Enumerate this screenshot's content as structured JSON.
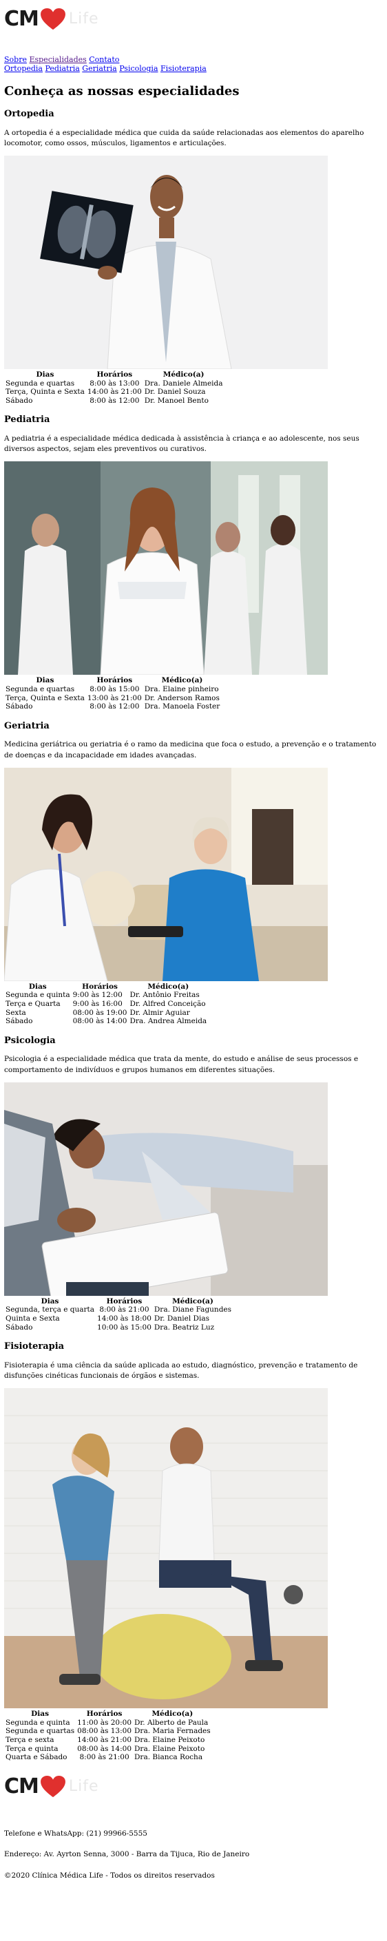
{
  "brand": {
    "logo_text": "CM",
    "logo_faded": "Life"
  },
  "nav": {
    "line1": [
      "Sobre",
      "Especialidades",
      "Contato"
    ],
    "line2": [
      "Ortopedia",
      "Pediatria",
      "Geriatria",
      "Psicologia",
      "Fisioterapia"
    ]
  },
  "page_title": "Conheça as nossas especialidades",
  "table_headers": [
    "Dias",
    "Horários",
    "Médico(a)"
  ],
  "sections": [
    {
      "title": "Ortopedia",
      "description": "A ortopedia é a especialidade médica que cuida da saúde relacionadas aos elementos do aparelho locomotor, como ossos, músculos, ligamentos e articulações.",
      "rows": [
        [
          "Segunda e quartas",
          "8:00 às 13:00",
          "Dra. Daniele Almeida"
        ],
        [
          "Terça, Quinta e Sexta",
          "14:00 às 21:00",
          "Dr. Daniel Souza"
        ],
        [
          "Sábado",
          "8:00 às 12:00",
          "Dr. Manoel Bento"
        ]
      ]
    },
    {
      "title": "Pediatria",
      "description": "A pediatria é a especialidade médica dedicada à assistência à criança e ao adolescente, nos seus diversos aspectos, sejam eles preventivos ou curativos.",
      "rows": [
        [
          "Segunda e quartas",
          "8:00 às 15:00",
          "Dra. Elaine pinheiro"
        ],
        [
          "Terça, Quinta e Sexta",
          "13:00 às 21:00",
          "Dr. Anderson Ramos"
        ],
        [
          "Sábado",
          "8:00 às 12:00",
          "Dra. Manoela Foster"
        ]
      ]
    },
    {
      "title": "Geriatria",
      "description": "Medicina geriátrica ou geriatria é o ramo da medicina que foca o estudo, a prevenção e o tratamento de doenças e da incapacidade em idades avançadas.",
      "rows": [
        [
          "Segunda e quinta",
          "9:00 às 12:00",
          "Dr. Antônio Freitas"
        ],
        [
          "Terça e Quarta",
          "9:00 às 16:00",
          "Dr. Alfred Conceição"
        ],
        [
          "Sexta",
          "08:00 às 19:00",
          "Dr. Almir Aguiar"
        ],
        [
          "Sábado",
          "08:00 às 14:00",
          "Dra. Andrea Almeida"
        ]
      ]
    },
    {
      "title": "Psicologia",
      "description": "Psicologia é a especialidade médica que trata da mente, do estudo e análise de seus processos e comportamento de indivíduos e grupos humanos em diferentes situações.",
      "rows": [
        [
          "Segunda, terça e quarta",
          "8:00 às 21:00",
          "Dra. Diane Fagundes"
        ],
        [
          "Quinta e Sexta",
          "14:00 às 18:00",
          "Dr. Daniel Dias"
        ],
        [
          "Sábado",
          "10:00 às 15:00",
          "Dra. Beatriz Luz"
        ]
      ]
    },
    {
      "title": "Fisioterapia",
      "description": "Fisioterapia é uma ciência da saúde aplicada ao estudo, diagnóstico, prevenção e tratamento de disfunções cinéticas funcionais de órgãos e sistemas.",
      "rows": [
        [
          "Segunda e quinta",
          "11:00 às 20:00",
          "Dr. Alberto de Paula"
        ],
        [
          "Segunda e quartas",
          "08:00 às 13:00",
          "Dra. Maria Fernades"
        ],
        [
          "Terça e sexta",
          "14:00 às 21:00",
          "Dra. Elaine Peixoto"
        ],
        [
          "Terça e quinta",
          "08:00 às 14:00",
          "Dra. Elaine Peixoto"
        ],
        [
          "Quarta e Sábado",
          "8:00 às 21:00",
          "Dra. Bianca Rocha"
        ]
      ]
    }
  ],
  "footer": {
    "phone": "Telefone e WhatsApp: (21) 99966-5555",
    "address": "Endereço: Av. Ayrton Senna, 3000 - Barra da Tijuca, Rio de Janeiro",
    "copyright": "©2020 Clínica Médica Life - Todos os direitos reservados"
  }
}
